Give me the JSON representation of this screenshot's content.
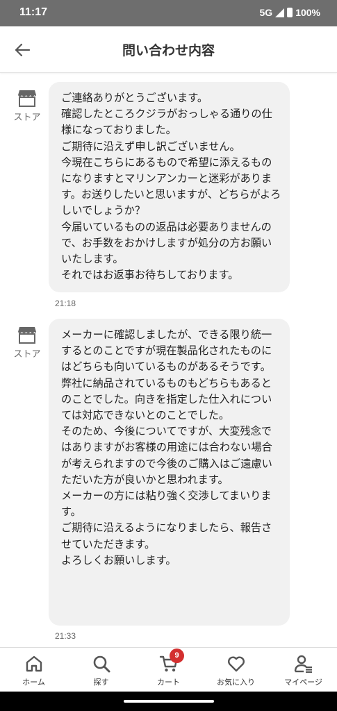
{
  "status_bar": {
    "time": "11:17",
    "network": "5G",
    "battery": "100%"
  },
  "header": {
    "title": "問い合わせ内容"
  },
  "messages": [
    {
      "sender": "ストア",
      "text": "ご連絡ありがとうございます。\n確認したところクジラがおっしゃる通りの仕様になっておりました。\nご期待に沿えず申し訳ございません。\n今現在こちらにあるもので希望に添えるものになりますとマリンアンカーと迷彩があります。お送りしたいと思いますが、どちらがよろしいでしょうか？\n今届いているものの返品は必要ありませんので、お手数をおかけしますが処分の方お願いいたします。\nそれではお返事お待ちしております。",
      "time": "21:18"
    },
    {
      "sender": "ストア",
      "text": "メーカーに確認しましたが、できる限り統一するとのことですが現在製品化されたものにはどちらも向いているものがあるそうです。\n弊社に納品されているものもどちらもあるとのことでした。向きを指定した仕入れについては対応できないとのことでした。\nそのため、今後についてですが、大変残念ではありますがお客様の用途には合わない場合が考えられますので今後のご購入はご遠慮いただいた方が良いかと思われます。\nメーカーの方には粘り強く交渉してまいります。\nご期待に沿えるようになりましたら、報告させていただきます。\nよろしくお願いします。",
      "time": "21:33"
    }
  ],
  "bottom_nav": {
    "items": [
      {
        "label": "ホーム",
        "icon": "home-icon"
      },
      {
        "label": "探す",
        "icon": "search-icon"
      },
      {
        "label": "カート",
        "icon": "cart-icon",
        "badge": "9"
      },
      {
        "label": "お気に入り",
        "icon": "heart-icon"
      },
      {
        "label": "マイページ",
        "icon": "user-icon"
      }
    ]
  },
  "colors": {
    "badge": "#d32f2f",
    "bubble": "#f1f1f1",
    "status_bar": "#6e6e6e"
  }
}
